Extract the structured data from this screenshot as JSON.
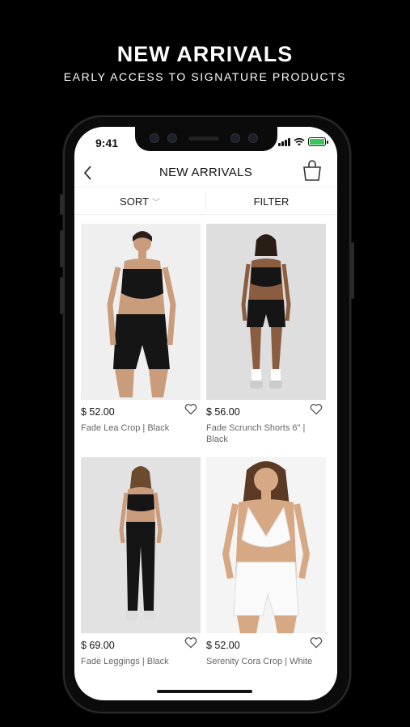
{
  "promo": {
    "title": "NEW ARRIVALS",
    "subtitle": "EARLY ACCESS TO SIGNATURE PRODUCTS"
  },
  "status_bar": {
    "time": "9:41",
    "battery_color": "#3cc45a"
  },
  "header": {
    "title": "NEW ARRIVALS",
    "back_icon": "chevron-left-icon",
    "cart_icon": "shopping-bag-icon"
  },
  "toolbar": {
    "sort_label": "SORT",
    "filter_label": "FILTER"
  },
  "products": [
    {
      "price": "$ 52.00",
      "name": "Fade Lea Crop | Black",
      "outfit": "black"
    },
    {
      "price": "$ 56.00",
      "name": "Fade Scrunch Shorts 6\" | Black",
      "outfit": "black"
    },
    {
      "price": "$ 69.00",
      "name": "Fade Leggings | Black",
      "outfit": "black"
    },
    {
      "price": "$ 52.00",
      "name": "Serenity Cora Crop | White",
      "outfit": "white"
    }
  ]
}
